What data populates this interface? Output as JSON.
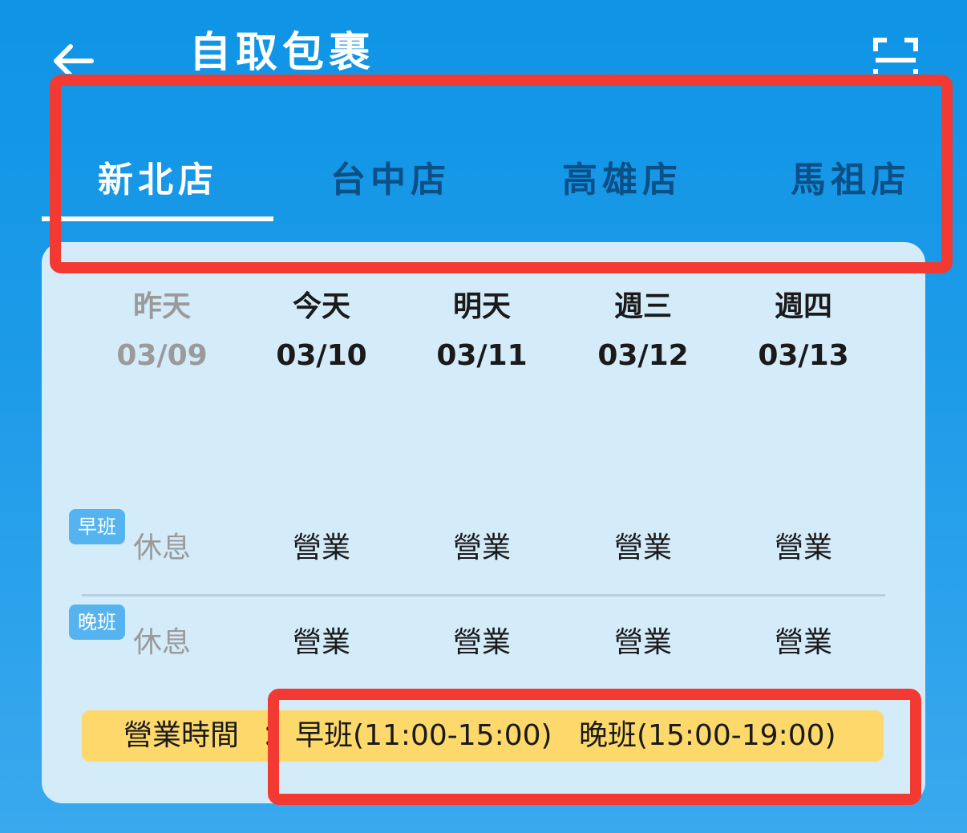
{
  "header": {
    "title": "自取包裹",
    "back_icon": "back-arrow-icon",
    "scan_icon": "scan-icon"
  },
  "tabs": [
    {
      "label": "新北店",
      "active": true
    },
    {
      "label": "台中店",
      "active": false
    },
    {
      "label": "高雄店",
      "active": false
    },
    {
      "label": "馬祖店",
      "active": false
    }
  ],
  "days": [
    {
      "name": "昨天",
      "date": "03/09",
      "past": true
    },
    {
      "name": "今天",
      "date": "03/10",
      "past": false
    },
    {
      "name": "明天",
      "date": "03/11",
      "past": false
    },
    {
      "name": "週三",
      "date": "03/12",
      "past": false
    },
    {
      "name": "週四",
      "date": "03/13",
      "past": false
    }
  ],
  "shifts": [
    {
      "label": "早班",
      "status": [
        "休息",
        "營業",
        "營業",
        "營業",
        "營業"
      ]
    },
    {
      "label": "晚班",
      "status": [
        "休息",
        "營業",
        "營業",
        "營業",
        "營業"
      ]
    }
  ],
  "hours": {
    "label": "營業時間",
    "separator": "：",
    "morning": "早班(11:00-15:00)",
    "evening": "晚班(15:00-19:00)"
  },
  "colors": {
    "background": "#0f94e6",
    "panel": "#d4ebfa",
    "active_tab": "#ffffff",
    "inactive_tab": "#0b4f87",
    "badge": "#55b4f0",
    "hours_bar": "#fdd86b",
    "highlight": "#f33a32"
  }
}
